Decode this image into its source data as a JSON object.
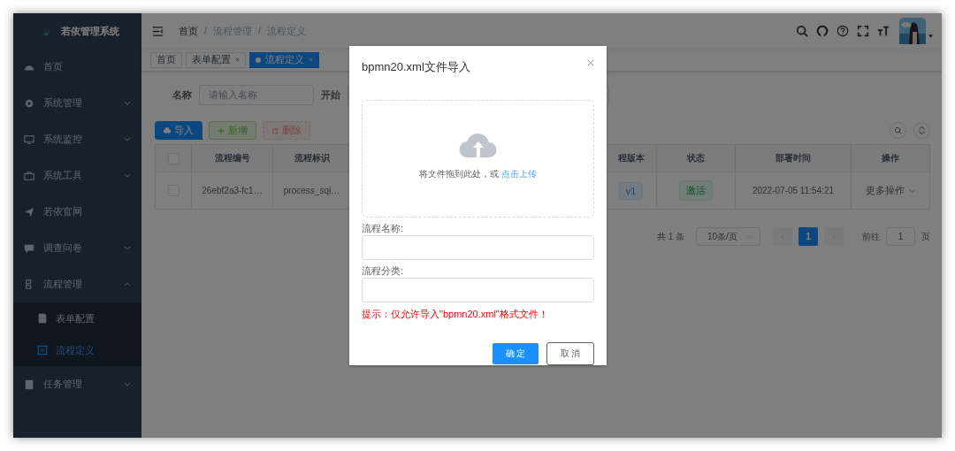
{
  "sidebar": {
    "title": "若依管理系统",
    "items": [
      {
        "label": "首页",
        "expandable": false
      },
      {
        "label": "系统管理",
        "expandable": true,
        "expanded": false
      },
      {
        "label": "系统监控",
        "expandable": true,
        "expanded": false
      },
      {
        "label": "系统工具",
        "expandable": true,
        "expanded": false
      },
      {
        "label": "若依官网",
        "expandable": false
      },
      {
        "label": "调查问卷",
        "expandable": true,
        "expanded": false
      },
      {
        "label": "流程管理",
        "expandable": true,
        "expanded": true,
        "children": [
          {
            "label": "表单配置",
            "selected": false
          },
          {
            "label": "流程定义",
            "selected": true
          }
        ]
      },
      {
        "label": "任务管理",
        "expandable": true,
        "expanded": false
      }
    ]
  },
  "header": {
    "breadcrumb": [
      "首页",
      "流程管理",
      "流程定义"
    ],
    "separator": "/"
  },
  "tags": [
    {
      "label": "首页",
      "closable": false,
      "selected": false
    },
    {
      "label": "表单配置",
      "closable": true,
      "selected": false
    },
    {
      "label": "流程定义",
      "closable": true,
      "selected": true
    }
  ],
  "search_form": {
    "fields": [
      {
        "label": "名称",
        "placeholder": "请输入名称"
      },
      {
        "label": "开始"
      }
    ]
  },
  "toolbar": {
    "buttons": [
      {
        "label": "导入",
        "kind": "primary",
        "disabled": false
      },
      {
        "label": "新增",
        "kind": "success",
        "disabled": false
      },
      {
        "label": "删除",
        "kind": "danger",
        "disabled": true
      }
    ]
  },
  "table": {
    "header_checked": false,
    "columns": [
      "流程编号",
      "流程标识",
      "程版本",
      "状态",
      "部署时间",
      "操作"
    ],
    "rows": [
      {
        "checked": false,
        "cells": [
          "26ebf2a3-fc1…",
          "process_sqi…",
          "v1",
          "激活",
          "2022-07-05 11:54:21",
          "更多操作"
        ]
      }
    ]
  },
  "pagination": {
    "total": "共 1 条",
    "page_size": "10条/页",
    "pages": [
      {
        "label": "1",
        "selected": true
      }
    ],
    "goto_label": "前往",
    "goto_value": "1",
    "goto_suffix": "页"
  },
  "dialog": {
    "title": "bpmn20.xml文件导入",
    "upload_text": "将文件拖到此处，或",
    "upload_link": "点击上传",
    "fields": [
      {
        "label": "流程名称:"
      },
      {
        "label": "流程分类:"
      }
    ],
    "hint": "提示：仅允许导入\"bpmn20.xml\"格式文件！",
    "buttons": [
      {
        "label": "确 定",
        "kind": "primary"
      },
      {
        "label": "取 消",
        "kind": "default"
      }
    ]
  }
}
